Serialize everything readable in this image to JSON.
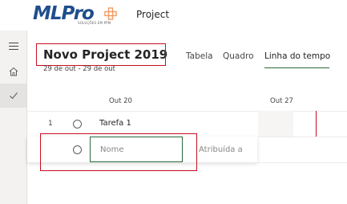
{
  "brand": {
    "logo_text": "MLPro",
    "logo_subtext": "SOLUÇÕES EM PPM",
    "accent": "#2b6a3d",
    "logo_color": "#1f4e8c",
    "logo_plus_color": "#f29a62"
  },
  "header": {
    "app_title": "Project"
  },
  "left_rail": {
    "items": [
      {
        "icon": "hamburger-menu-icon"
      },
      {
        "icon": "home-icon"
      },
      {
        "icon": "checkmark-icon",
        "active": true
      }
    ]
  },
  "project": {
    "title": "Novo Project 2019",
    "date_range": "29 de out - 29 de out"
  },
  "tabs": [
    {
      "label": "Tabela",
      "active": false
    },
    {
      "label": "Quadro",
      "active": false
    },
    {
      "label": "Linha do tempo",
      "active": true
    }
  ],
  "timeline": {
    "columns": [
      "Out 20",
      "Out 27"
    ],
    "today_line_color": "#c50f1f"
  },
  "tasks": [
    {
      "number": "1",
      "name": "Tarefa 1"
    }
  ],
  "new_task": {
    "name_placeholder": "Nome",
    "assigned_label": "Atribuída a"
  },
  "annotation_color": "#c50f1f"
}
